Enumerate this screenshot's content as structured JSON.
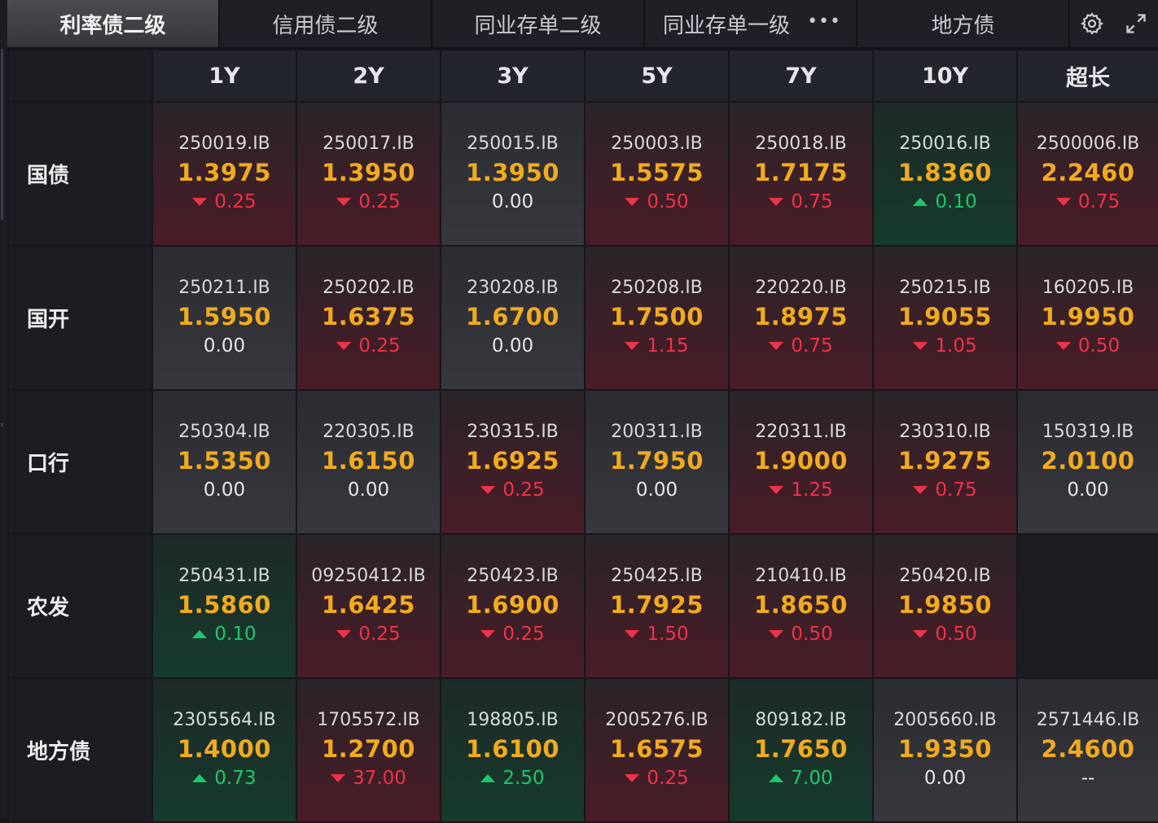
{
  "tabs": [
    {
      "label": "利率债二级",
      "active": true
    },
    {
      "label": "信用债二级",
      "active": false
    },
    {
      "label": "同业存单二级",
      "active": false
    },
    {
      "label": "同业存单一级",
      "active": false,
      "more": "•••"
    },
    {
      "label": "地方债",
      "active": false
    }
  ],
  "tools": {
    "settings_icon": "gear-icon",
    "expand_icon": "expand-icon"
  },
  "columns": [
    "1Y",
    "2Y",
    "3Y",
    "5Y",
    "7Y",
    "10Y",
    "超长"
  ],
  "colors": {
    "yield": "#f2ab1e",
    "down": "#f0324c",
    "up": "#1fc66f"
  },
  "rows": [
    {
      "label": "国债",
      "cells": [
        {
          "code": "250019.IB",
          "yield": "1.3975",
          "change": "0.25",
          "dir": "down"
        },
        {
          "code": "250017.IB",
          "yield": "1.3950",
          "change": "0.25",
          "dir": "down"
        },
        {
          "code": "250015.IB",
          "yield": "1.3950",
          "change": "0.00",
          "dir": "flat"
        },
        {
          "code": "250003.IB",
          "yield": "1.5575",
          "change": "0.50",
          "dir": "down"
        },
        {
          "code": "250018.IB",
          "yield": "1.7175",
          "change": "0.75",
          "dir": "down"
        },
        {
          "code": "250016.IB",
          "yield": "1.8360",
          "change": "0.10",
          "dir": "up"
        },
        {
          "code": "2500006.IB",
          "yield": "2.2460",
          "change": "0.75",
          "dir": "down"
        }
      ]
    },
    {
      "label": "国开",
      "cells": [
        {
          "code": "250211.IB",
          "yield": "1.5950",
          "change": "0.00",
          "dir": "flat"
        },
        {
          "code": "250202.IB",
          "yield": "1.6375",
          "change": "0.25",
          "dir": "down"
        },
        {
          "code": "230208.IB",
          "yield": "1.6700",
          "change": "0.00",
          "dir": "flat"
        },
        {
          "code": "250208.IB",
          "yield": "1.7500",
          "change": "1.15",
          "dir": "down"
        },
        {
          "code": "220220.IB",
          "yield": "1.8975",
          "change": "0.75",
          "dir": "down"
        },
        {
          "code": "250215.IB",
          "yield": "1.9055",
          "change": "1.05",
          "dir": "down"
        },
        {
          "code": "160205.IB",
          "yield": "1.9950",
          "change": "0.50",
          "dir": "down"
        }
      ]
    },
    {
      "label": "口行",
      "cells": [
        {
          "code": "250304.IB",
          "yield": "1.5350",
          "change": "0.00",
          "dir": "flat"
        },
        {
          "code": "220305.IB",
          "yield": "1.6150",
          "change": "0.00",
          "dir": "flat"
        },
        {
          "code": "230315.IB",
          "yield": "1.6925",
          "change": "0.25",
          "dir": "down"
        },
        {
          "code": "200311.IB",
          "yield": "1.7950",
          "change": "0.00",
          "dir": "flat"
        },
        {
          "code": "220311.IB",
          "yield": "1.9000",
          "change": "1.25",
          "dir": "down"
        },
        {
          "code": "230310.IB",
          "yield": "1.9275",
          "change": "0.75",
          "dir": "down"
        },
        {
          "code": "150319.IB",
          "yield": "2.0100",
          "change": "0.00",
          "dir": "flat"
        }
      ]
    },
    {
      "label": "农发",
      "cells": [
        {
          "code": "250431.IB",
          "yield": "1.5860",
          "change": "0.10",
          "dir": "up"
        },
        {
          "code": "09250412.IB",
          "yield": "1.6425",
          "change": "0.25",
          "dir": "down"
        },
        {
          "code": "250423.IB",
          "yield": "1.6900",
          "change": "0.25",
          "dir": "down"
        },
        {
          "code": "250425.IB",
          "yield": "1.7925",
          "change": "1.50",
          "dir": "down"
        },
        {
          "code": "210410.IB",
          "yield": "1.8650",
          "change": "0.50",
          "dir": "down"
        },
        {
          "code": "250420.IB",
          "yield": "1.9850",
          "change": "0.50",
          "dir": "down"
        },
        {
          "code": "",
          "yield": "",
          "change": "",
          "dir": "empty"
        }
      ]
    },
    {
      "label": "地方债",
      "cells": [
        {
          "code": "2305564.IB",
          "yield": "1.4000",
          "change": "0.73",
          "dir": "up"
        },
        {
          "code": "1705572.IB",
          "yield": "1.2700",
          "change": "37.00",
          "dir": "down"
        },
        {
          "code": "198805.IB",
          "yield": "1.6100",
          "change": "2.50",
          "dir": "up"
        },
        {
          "code": "2005276.IB",
          "yield": "1.6575",
          "change": "0.25",
          "dir": "down"
        },
        {
          "code": "809182.IB",
          "yield": "1.7650",
          "change": "7.00",
          "dir": "up"
        },
        {
          "code": "2005660.IB",
          "yield": "1.9350",
          "change": "0.00",
          "dir": "flat"
        },
        {
          "code": "2571446.IB",
          "yield": "2.4600",
          "change": "--",
          "dir": "flat"
        }
      ]
    }
  ]
}
